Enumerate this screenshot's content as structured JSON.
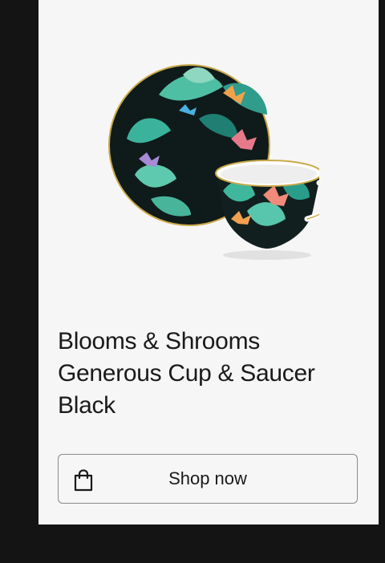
{
  "product": {
    "title_line1": "Blooms & Shrooms",
    "title_line2": "Generous Cup & Saucer",
    "title_line3": "Black",
    "image_icon": "teacup-saucer-image"
  },
  "cta": {
    "label": "Shop now",
    "icon": "shopping-bag-icon"
  },
  "colors": {
    "page_background": "#141414",
    "card_background": "#f6f6f6",
    "text": "#1a1a1a",
    "button_border": "#8a8a8a"
  }
}
